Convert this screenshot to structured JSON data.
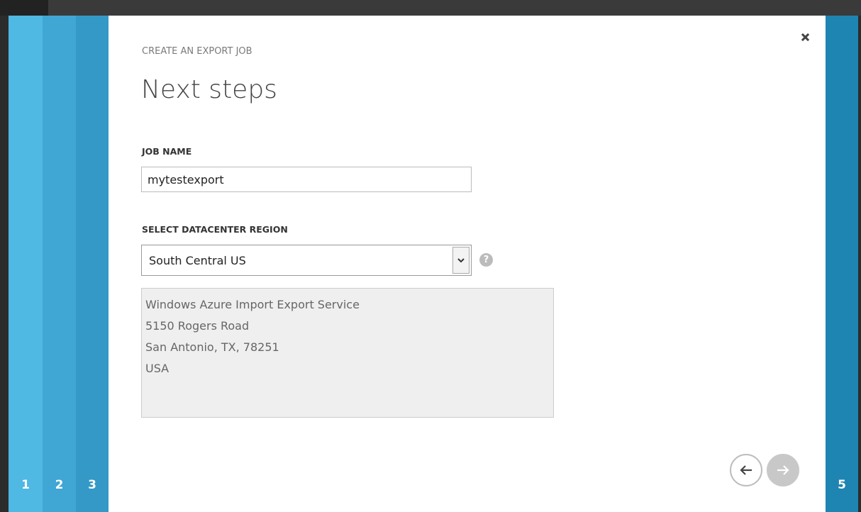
{
  "wizard": {
    "header": "CREATE AN EXPORT JOB",
    "title": "Next steps",
    "steps": [
      {
        "number": "1"
      },
      {
        "number": "2"
      },
      {
        "number": "3"
      },
      {
        "number": "5"
      }
    ]
  },
  "form": {
    "job_name_label": "JOB NAME",
    "job_name_value": "mytestexport",
    "region_label": "SELECT DATACENTER REGION",
    "region_value": "South Central US",
    "address_lines": [
      "Windows Azure Import Export Service",
      "5150 Rogers Road",
      "San Antonio, TX, 78251",
      "USA"
    ]
  },
  "icons": {
    "close": "close-icon",
    "help": "help-icon",
    "help_glyph": "?",
    "prev": "arrow-left-icon",
    "next": "arrow-right-icon",
    "dropdown": "chevron-down-icon"
  },
  "colors": {
    "step1": "#4fb8e3",
    "step2": "#40a6d4",
    "step3": "#3499c6",
    "step5": "#1e84b1"
  }
}
